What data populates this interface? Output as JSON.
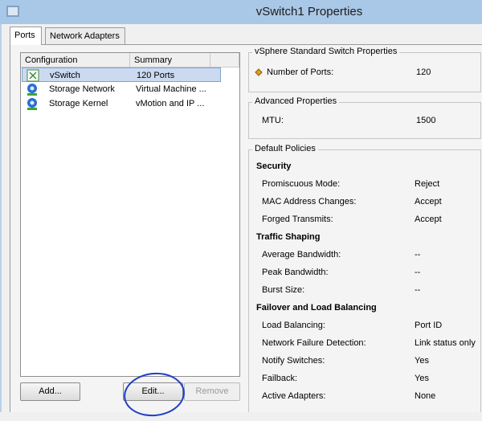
{
  "window": {
    "title": "vSwitch1 Properties"
  },
  "tabs": [
    {
      "label": "Ports"
    },
    {
      "label": "Network Adapters"
    }
  ],
  "list": {
    "headers": {
      "configuration": "Configuration",
      "summary": "Summary"
    },
    "rows": [
      {
        "name": "vSwitch",
        "summary": "120 Ports",
        "icon": "vswitch-icon"
      },
      {
        "name": "Storage Network",
        "summary": "Virtual Machine ...",
        "icon": "network-icon"
      },
      {
        "name": "Storage Kernel",
        "summary": "vMotion and IP ...",
        "icon": "network-icon"
      }
    ]
  },
  "buttons": {
    "add": "Add...",
    "edit": "Edit...",
    "remove": "Remove"
  },
  "standard": {
    "title": "vSphere Standard Switch Properties",
    "ports_label": "Number of Ports:",
    "ports_value": "120"
  },
  "advanced": {
    "title": "Advanced Properties",
    "mtu_label": "MTU:",
    "mtu_value": "1500"
  },
  "policies": {
    "title": "Default Policies",
    "security": {
      "heading": "Security",
      "promiscuous_label": "Promiscuous Mode:",
      "promiscuous_value": "Reject",
      "mac_label": "MAC Address Changes:",
      "mac_value": "Accept",
      "forged_label": "Forged Transmits:",
      "forged_value": "Accept"
    },
    "shaping": {
      "heading": "Traffic Shaping",
      "avg_label": "Average Bandwidth:",
      "avg_value": "--",
      "peak_label": "Peak Bandwidth:",
      "peak_value": "--",
      "burst_label": "Burst Size:",
      "burst_value": "--"
    },
    "failover": {
      "heading": "Failover and Load Balancing",
      "lb_label": "Load Balancing:",
      "lb_value": "Port ID",
      "nfd_label": "Network Failure Detection:",
      "nfd_value": "Link status only",
      "notify_label": "Notify Switches:",
      "notify_value": "Yes",
      "failback_label": "Failback:",
      "failback_value": "Yes",
      "active_label": "Active Adapters:",
      "active_value": "None"
    }
  },
  "colors": {
    "annotation": "#1f3fc8",
    "selection": "#cbdaf0"
  }
}
